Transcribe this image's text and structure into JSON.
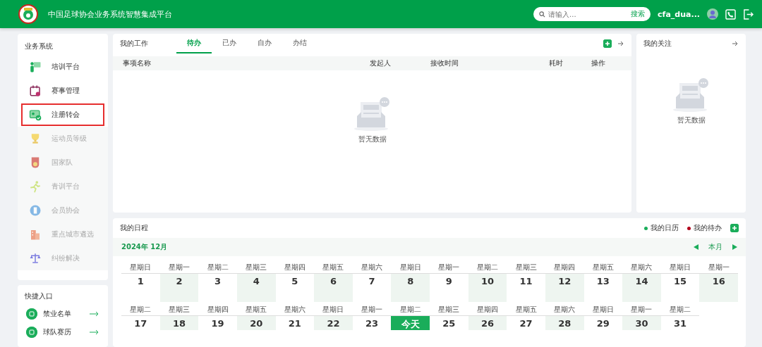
{
  "header": {
    "title": "中国足球协会业务系统智慧集成平台",
    "search": {
      "placeholder": "请输入...",
      "button": "搜索"
    },
    "username": "cfa_dua..."
  },
  "sidebar": {
    "title": "业务系统",
    "items": [
      {
        "label": "培训平台",
        "disabled": false,
        "highlighted": false
      },
      {
        "label": "赛事管理",
        "disabled": false,
        "highlighted": false
      },
      {
        "label": "注册转会",
        "disabled": false,
        "highlighted": true
      },
      {
        "label": "运动员等级",
        "disabled": true,
        "highlighted": false
      },
      {
        "label": "国家队",
        "disabled": true,
        "highlighted": false
      },
      {
        "label": "青训平台",
        "disabled": true,
        "highlighted": false
      },
      {
        "label": "会员协会",
        "disabled": true,
        "highlighted": false
      },
      {
        "label": "重点城市遴选",
        "disabled": true,
        "highlighted": false
      },
      {
        "label": "纠纷解决",
        "disabled": true,
        "highlighted": false
      }
    ]
  },
  "quick_links": {
    "title": "快捷入口",
    "items": [
      {
        "label": "禁业名单"
      },
      {
        "label": "球队赛历"
      }
    ]
  },
  "work": {
    "title": "我的工作",
    "tabs": [
      {
        "label": "待办",
        "selected": true
      },
      {
        "label": "已办",
        "selected": false
      },
      {
        "label": "自办",
        "selected": false
      },
      {
        "label": "办结",
        "selected": false
      }
    ],
    "columns": [
      "事项名称",
      "发起人",
      "接收时间",
      "耗时",
      "操作"
    ],
    "empty": "暂无数据"
  },
  "focus": {
    "title": "我的关注",
    "empty": "暂无数据"
  },
  "schedule": {
    "title": "我的日程",
    "legend": [
      {
        "label": "我的日历",
        "color": "#1aad5a"
      },
      {
        "label": "我的待办",
        "color": "#b3001b"
      }
    ],
    "month": "2024年 12月",
    "current": "本月",
    "weeks": [
      [
        {
          "weekday": "星期日",
          "day": "1",
          "today": false
        },
        {
          "weekday": "星期一",
          "day": "2",
          "today": false
        },
        {
          "weekday": "星期二",
          "day": "3",
          "today": false
        },
        {
          "weekday": "星期三",
          "day": "4",
          "today": false
        },
        {
          "weekday": "星期四",
          "day": "5",
          "today": false
        },
        {
          "weekday": "星期五",
          "day": "6",
          "today": false
        },
        {
          "weekday": "星期六",
          "day": "7",
          "today": false
        },
        {
          "weekday": "星期日",
          "day": "8",
          "today": false
        },
        {
          "weekday": "星期一",
          "day": "9",
          "today": false
        },
        {
          "weekday": "星期二",
          "day": "10",
          "today": false
        },
        {
          "weekday": "星期三",
          "day": "11",
          "today": false
        },
        {
          "weekday": "星期四",
          "day": "12",
          "today": false
        },
        {
          "weekday": "星期五",
          "day": "13",
          "today": false
        },
        {
          "weekday": "星期六",
          "day": "14",
          "today": false
        },
        {
          "weekday": "星期日",
          "day": "15",
          "today": false
        },
        {
          "weekday": "星期一",
          "day": "16",
          "today": false
        }
      ],
      [
        {
          "weekday": "星期二",
          "day": "17",
          "today": false
        },
        {
          "weekday": "星期三",
          "day": "18",
          "today": false
        },
        {
          "weekday": "星期四",
          "day": "19",
          "today": false
        },
        {
          "weekday": "星期五",
          "day": "20",
          "today": false
        },
        {
          "weekday": "星期六",
          "day": "21",
          "today": false
        },
        {
          "weekday": "星期日",
          "day": "22",
          "today": false
        },
        {
          "weekday": "星期一",
          "day": "23",
          "today": false
        },
        {
          "weekday": "星期二",
          "day": "今天",
          "today": true
        },
        {
          "weekday": "星期三",
          "day": "25",
          "today": false
        },
        {
          "weekday": "星期四",
          "day": "26",
          "today": false
        },
        {
          "weekday": "星期五",
          "day": "27",
          "today": false
        },
        {
          "weekday": "星期六",
          "day": "28",
          "today": false
        },
        {
          "weekday": "星期日",
          "day": "29",
          "today": false
        },
        {
          "weekday": "星期一",
          "day": "30",
          "today": false
        },
        {
          "weekday": "星期二",
          "day": "31",
          "today": false
        }
      ]
    ]
  }
}
